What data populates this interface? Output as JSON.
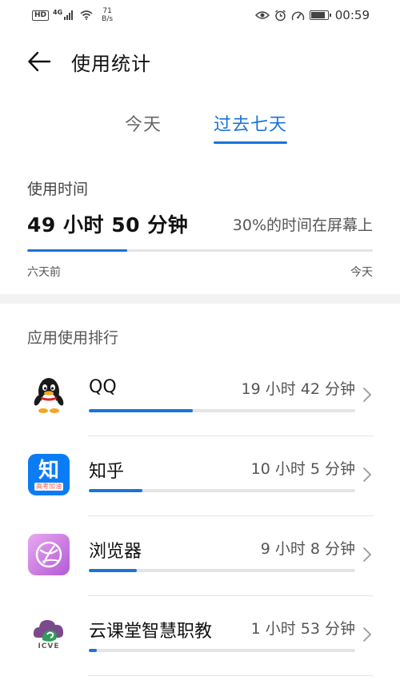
{
  "status_bar": {
    "hd": "HD",
    "network": "4G",
    "speed_value": "71",
    "speed_unit": "B/s",
    "time": "00:59",
    "icons": [
      "eye-icon",
      "alarm-icon",
      "speedometer-icon",
      "battery-icon"
    ]
  },
  "header": {
    "title": "使用统计",
    "back_icon": "arrow-left-icon"
  },
  "tabs": [
    {
      "label": "今天",
      "selected": false
    },
    {
      "label": "过去七天",
      "selected": true
    }
  ],
  "usage": {
    "label": "使用时间",
    "total": "49 小时 50 分钟",
    "screen_percent_text": "30%的时间在屏幕上",
    "progress": 0.29,
    "range_start": "六天前",
    "range_end": "今天"
  },
  "ranking": {
    "title": "应用使用排行",
    "apps": [
      {
        "name": "QQ",
        "time": "19 小时 42 分钟",
        "progress": 0.39,
        "icon": "qq-penguin-icon"
      },
      {
        "name": "知乎",
        "time": "10 小时 5 分钟",
        "progress": 0.2,
        "icon": "zhihu-icon",
        "icon_text": "知",
        "icon_subtext": "高考加油"
      },
      {
        "name": "浏览器",
        "time": "9 小时 8 分钟",
        "progress": 0.18,
        "icon": "browser-icon"
      },
      {
        "name": "云课堂智慧职教",
        "time": "1 小时 53 分钟",
        "progress": 0.03,
        "icon": "icve-icon",
        "icon_text": "ICVE"
      }
    ]
  },
  "colors": {
    "accent": "#1a73d9",
    "track": "#e4e4e4",
    "divider_band": "#f2f2f2"
  }
}
